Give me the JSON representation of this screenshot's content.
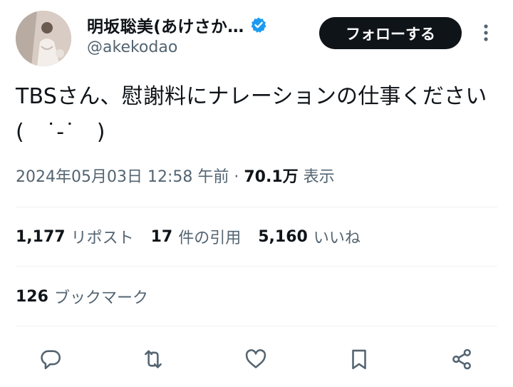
{
  "author": {
    "display_name": "明坂聡美(あけさか…",
    "handle": "@akekodao",
    "verified": true
  },
  "follow_label": "フォローする",
  "tweet": {
    "text": "TBSさん、慰謝料にナレーションの仕事ください(　˙-˙　)"
  },
  "meta": {
    "timestamp": "2024年05月03日 12:58 午前",
    "separator": "·",
    "views_count": "70.1万",
    "views_label": "表示"
  },
  "stats": {
    "reposts_count": "1,177",
    "reposts_label": "リポスト",
    "quotes_count": "17",
    "quotes_label": "件の引用",
    "likes_count": "5,160",
    "likes_label": "いいね"
  },
  "bookmarks": {
    "count": "126",
    "label": "ブックマーク"
  },
  "icons": {
    "verified": "verified-badge-icon",
    "more": "more-vertical-icon",
    "reply": "reply-icon",
    "retweet": "retweet-icon",
    "like": "heart-icon",
    "bookmark": "bookmark-icon",
    "share": "share-icon"
  },
  "colors": {
    "primary_text": "#0f1419",
    "secondary_text": "#536471",
    "verified_blue": "#1d9bf0",
    "follow_button_bg": "#0f1419",
    "divider": "#eff3f4"
  }
}
